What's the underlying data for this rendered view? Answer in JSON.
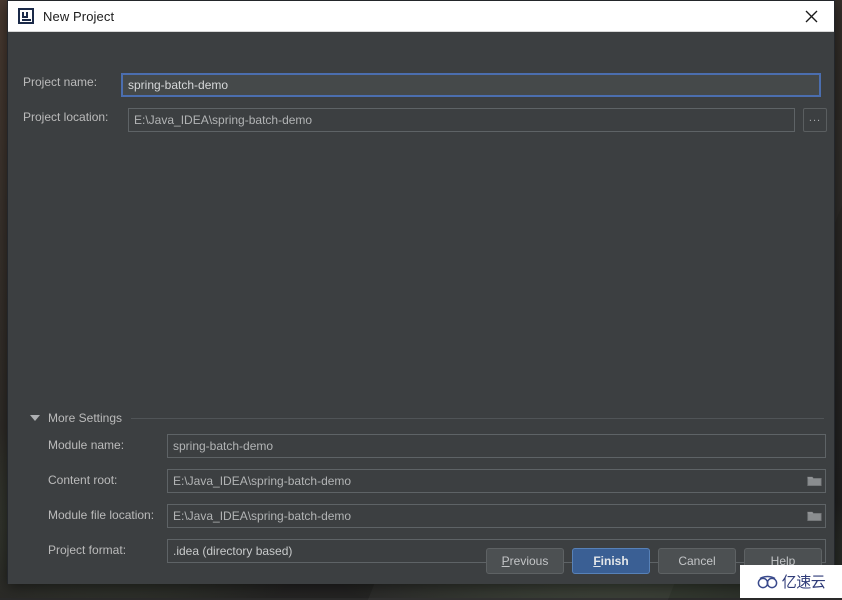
{
  "window": {
    "title": "New Project",
    "app_icon": "intellij-idea-icon",
    "close_icon": "close-icon"
  },
  "form": {
    "project_name": {
      "label": "Project name:",
      "value": "spring-batch-demo",
      "placeholder": ""
    },
    "project_location": {
      "label": "Project location:",
      "value": "E:\\Java_IDEA\\spring-batch-demo",
      "placeholder": "",
      "browse_label": "..."
    }
  },
  "more_settings": {
    "label": "More Settings",
    "expanded": true,
    "toggle_icon": "chevron-down-icon",
    "fields": {
      "module_name": {
        "label": "Module name:",
        "value": "spring-batch-demo"
      },
      "content_root": {
        "label": "Content root:",
        "value": "E:\\Java_IDEA\\spring-batch-demo",
        "browse_icon": "folder-icon"
      },
      "module_file_location": {
        "label": "Module file location:",
        "value": "E:\\Java_IDEA\\spring-batch-demo",
        "browse_icon": "folder-icon"
      },
      "project_format": {
        "label": "Project format:",
        "value": ".idea (directory based)",
        "dropdown_icon": "chevron-down-icon"
      }
    }
  },
  "buttons": {
    "previous": {
      "label": "Previous",
      "mnemonic": "P"
    },
    "finish": {
      "label": "Finish",
      "mnemonic": "F",
      "primary": true
    },
    "cancel": {
      "label": "Cancel"
    },
    "help": {
      "label": "Help"
    }
  },
  "watermark": {
    "text": "亿速云",
    "logo_icon": "cloud-logo-icon"
  },
  "colors": {
    "dialog_background": "#3c3f41",
    "titlebar_background": "#ffffff",
    "field_border": "#5e6366",
    "focus_border": "#4b6eaf",
    "primary_button": "#3a5f94",
    "label_text": "#bbbbbb",
    "value_text": "#c8cacb"
  }
}
